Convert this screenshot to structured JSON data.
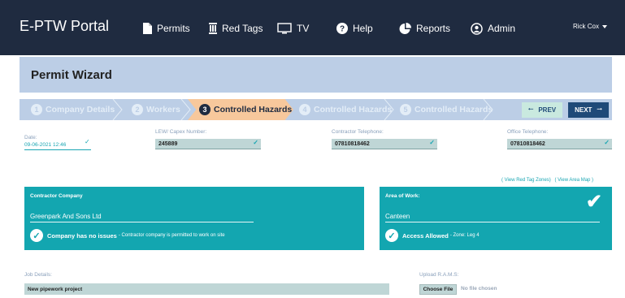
{
  "app": {
    "title": "E-PTW Portal"
  },
  "nav": {
    "items": [
      {
        "label": "Permits",
        "icon": "document-icon"
      },
      {
        "label": "Red Tags",
        "icon": "tag-icon"
      },
      {
        "label": "TV",
        "icon": "monitor-icon"
      },
      {
        "label": "Help",
        "icon": "question-icon"
      },
      {
        "label": "Reports",
        "icon": "pie-chart-icon"
      },
      {
        "label": "Admin",
        "icon": "user-circle-icon"
      }
    ],
    "user": "Rick Cox"
  },
  "wizard": {
    "title": "Permit Wizard",
    "steps": [
      {
        "num": "1",
        "label": "Company Details"
      },
      {
        "num": "2",
        "label": "Workers"
      },
      {
        "num": "3",
        "label": "Controlled Hazards"
      },
      {
        "num": "4",
        "label": "Controlled Hazards"
      },
      {
        "num": "5",
        "label": "Controlled Hazards"
      }
    ],
    "prev_label": "PREV",
    "next_label": "NEXT"
  },
  "fields": {
    "date_label": "Date:",
    "date_value": "09-06-2021 12:46",
    "lew_label": "LEW/ Capex Number:",
    "lew_value": "245889",
    "contractor_tel_label": "Contractor Telephone:",
    "contractor_tel_value": "07810818462",
    "office_tel_label": "Office Telephone:",
    "office_tel_value": "07810818462"
  },
  "links": {
    "red_tag": "( View Red Tag Zones)",
    "area_map": "( View Area Map )"
  },
  "contractor": {
    "title": "Contractor Company",
    "name": "Greenpark And Sons Ltd",
    "status_bold": "Company has no issues",
    "status_text": "- Contractor company is permitted to work on site"
  },
  "area": {
    "title": "Area of Work:",
    "name": "Canteen",
    "status_bold": "Access Allowed",
    "status_text": "- Zone: Leg 4"
  },
  "job": {
    "label": "Job Details:",
    "value": "New pipework project"
  },
  "upload": {
    "label": "Upload R.A.M.S:",
    "button": "Choose File",
    "nofile": "No file chosen"
  },
  "colors": {
    "nav": "#1f2b40",
    "accent": "#13a6b0",
    "active_step": "#f7c89c",
    "header_bg": "#bccee6"
  }
}
